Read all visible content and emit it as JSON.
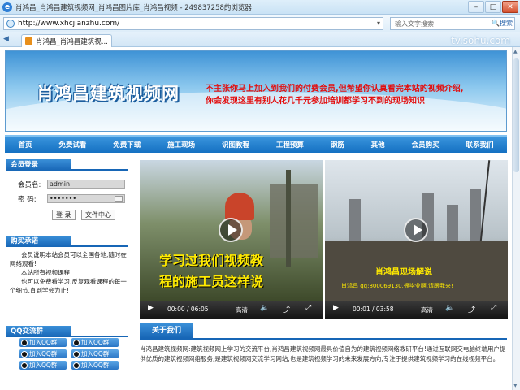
{
  "window": {
    "title": "肖鸿昌_肖鸿昌建筑视频网_肖鸿昌图片库_肖鸿昌视频 - 249837258的浏览器",
    "minimize": "–",
    "maximize": "□",
    "close": "✕"
  },
  "address_bar": {
    "url": "http://www.xhcjianzhu.com/",
    "search_placeholder": "输入文字搜索",
    "search_go": "🔍搜索"
  },
  "tab": {
    "label": "肖鸿昌_肖鸿昌建筑视..."
  },
  "watermark": "tv.sohu.com",
  "banner": {
    "brand": "肖鸿昌建筑视频网",
    "ad_line1": "不主张你马上加入到我们的付费会员,但希望你认真看完本站的视频介绍,",
    "ad_line2": "你会发现这里有别人花几千元参加培训都学习不到的现场知识"
  },
  "nav": [
    "首页",
    "免费试看",
    "免费下载",
    "施工现场",
    "识图教程",
    "工程预算",
    "钢筋",
    "其他",
    "会员购买",
    "联系我们"
  ],
  "login": {
    "heading": "会员登录",
    "username_label": "会员名:",
    "username_value": "admin",
    "password_label": "密  码:",
    "password_value": "•••••••",
    "login_button": "登 录",
    "member_center_button": "文件中心"
  },
  "purchase": {
    "heading": "购买承诺",
    "lines": [
      "会员说明本站会员可以全国各地,随时在网络观看!",
      "本站所有视频课程!",
      "也可以免费看学习,反复观看课程的每一个细节,直到学会为止!"
    ]
  },
  "qq": {
    "heading": "QQ交流群",
    "buttons": [
      "加入QQ群",
      "加入QQ群",
      "加入QQ群",
      "加入QQ群",
      "加入QQ群",
      "加入QQ群"
    ]
  },
  "player1": {
    "subtitle_line1": "学习过我们视频教",
    "subtitle_line2": "程的施工员这样说",
    "time": "00:00 / 06:05",
    "quality": "高清"
  },
  "player2": {
    "subtitle_line1": "肖鸿昌现场解说",
    "subtitle_line2": "肖鸿昌 qq:800069130,很毕业啊,请跟我来!",
    "time": "00:01 / 03:58",
    "quality": "高清"
  },
  "about": {
    "heading": "关于我们",
    "text": "肖鸿昌建筑视频网:建筑视频网上学习的交流平台,肖鸿昌建筑视频网最具价值自为的建筑视频网络教研平台!通过互联网交电脑终端用户提供优质的建筑视频网络服务,是建筑视频网交流学习网站,也是建筑视频学习的未来发展方向,专注于提供建筑视频学习的在线视频平台。"
  }
}
